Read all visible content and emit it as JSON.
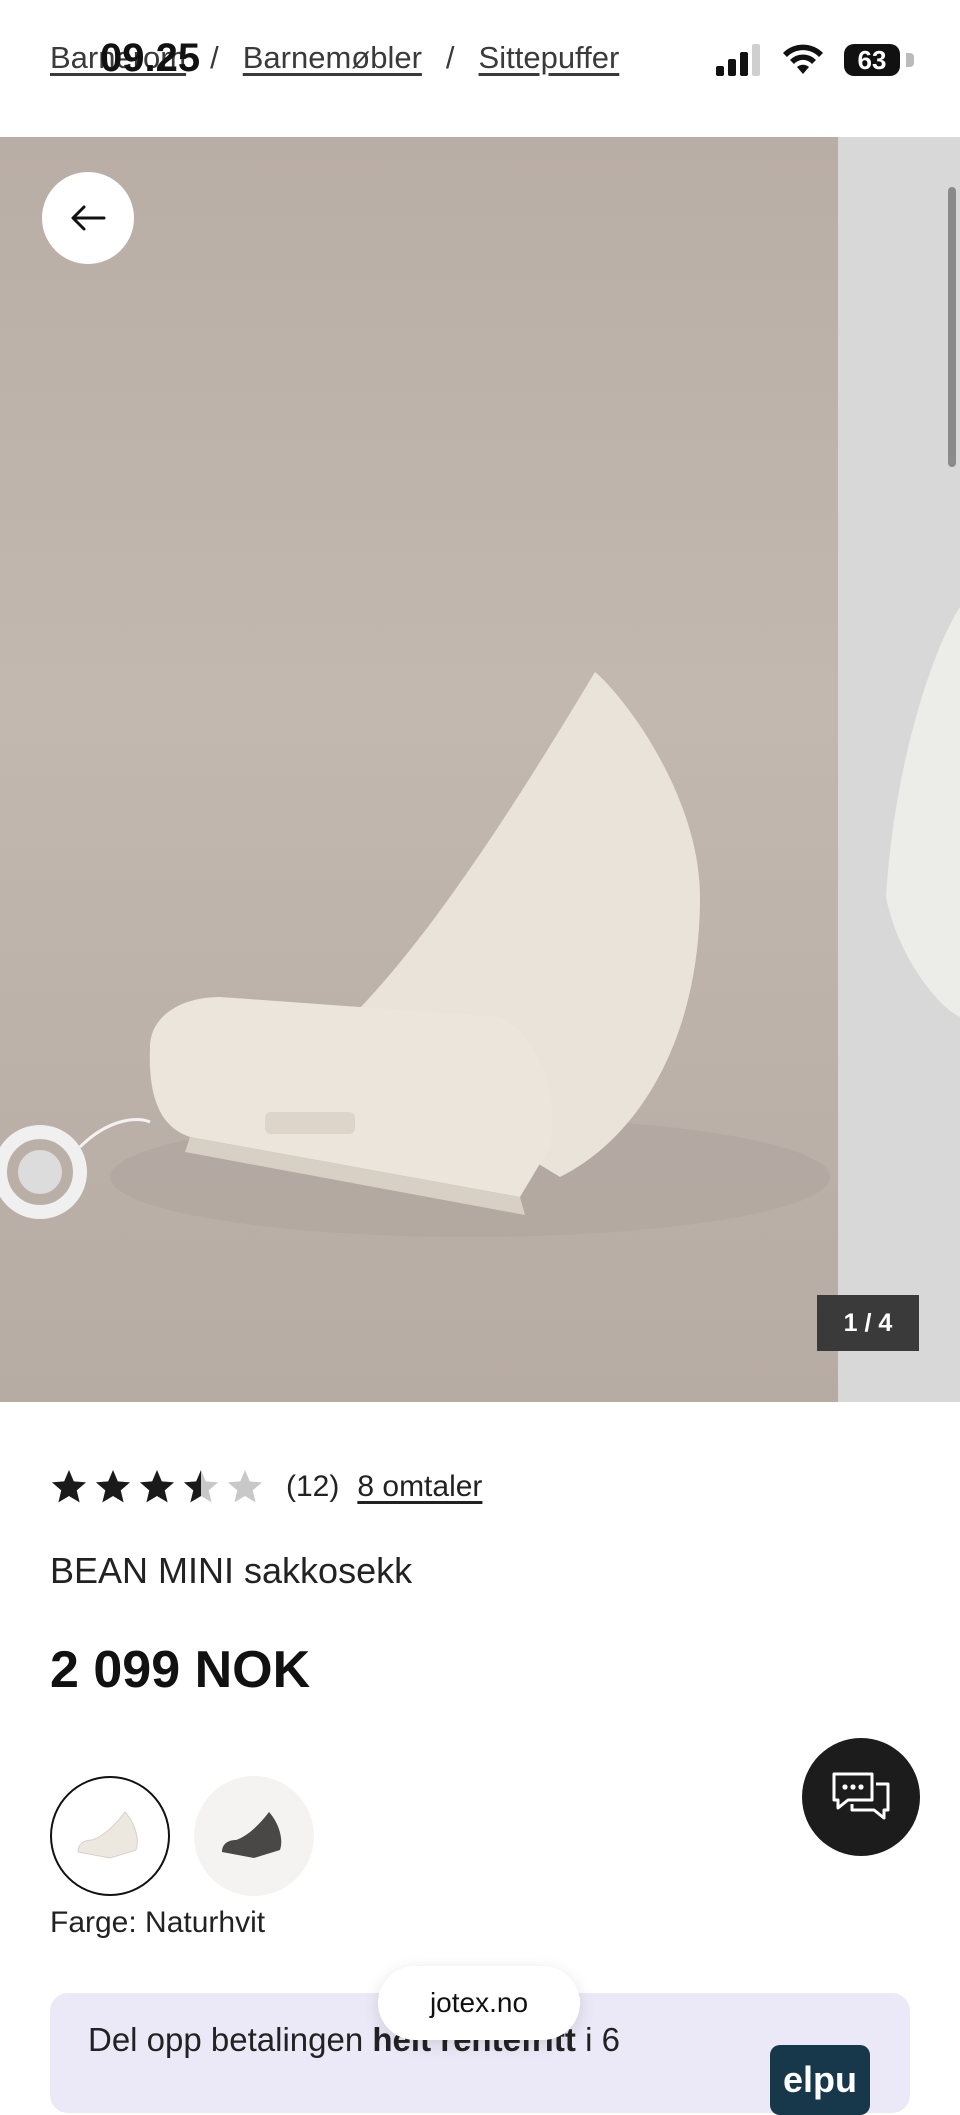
{
  "status_bar": {
    "time": "09.25",
    "battery": "63"
  },
  "breadcrumb": {
    "items": [
      "Barnerom",
      "Barnemøbler",
      "Sittepuffer"
    ],
    "separator": "/"
  },
  "gallery": {
    "counter": "1 / 4",
    "background_color": "#bfb5ad"
  },
  "product": {
    "rating_value": 3.5,
    "rating_max": 5,
    "rating_count": "(12)",
    "reviews_link": "8 omtaler",
    "title": "BEAN MINI sakkosekk",
    "price": "2 099 NOK",
    "color_label": "Farge: Naturhvit",
    "swatches": [
      {
        "name": "Naturhvit",
        "color": "#ece8e0",
        "selected": true
      },
      {
        "name": "Mørk grå",
        "color": "#4a4846",
        "selected": false
      }
    ]
  },
  "installment": {
    "text_prefix": "Del opp betalingen ",
    "text_bold": "helt rentefritt",
    "text_suffix": " i 6",
    "brand": "elpu"
  },
  "browser": {
    "url": "jotex.no"
  },
  "colors": {
    "accent": "#1c1c1c",
    "installment_bg": "#ebe9f7"
  }
}
